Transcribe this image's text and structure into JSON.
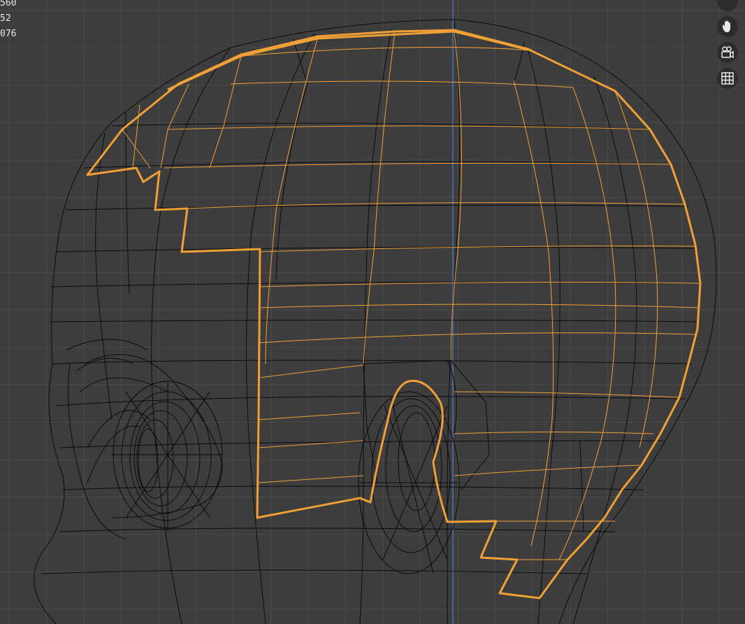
{
  "viewport": {
    "stats": [
      "560",
      "52",
      "076"
    ],
    "colors": {
      "background": "#3d3d3d",
      "grid": "#4a4a4a",
      "wire": "#0b0b0b",
      "selection": "#f0a035",
      "axis": "#4f6fbd"
    }
  },
  "gizmo": {
    "buttons": [
      {
        "icon": "hand-pan-icon"
      },
      {
        "icon": "camera-icon"
      },
      {
        "icon": "grid-icon"
      }
    ]
  }
}
